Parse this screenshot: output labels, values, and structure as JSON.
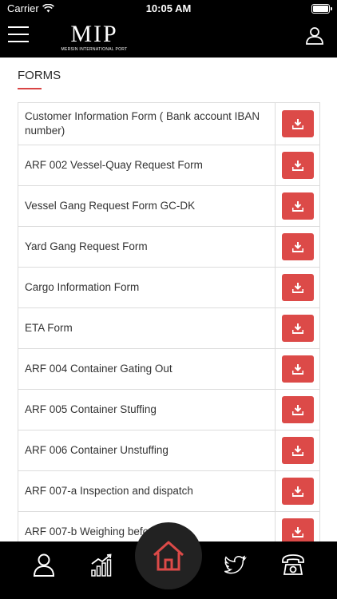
{
  "status": {
    "carrier": "Carrier",
    "time": "10:05 AM"
  },
  "header": {
    "logo_mark": "MIP",
    "logo_sub": "MERSIN INTERNATIONAL PORT",
    "icons": [
      "menu-icon",
      "user-icon"
    ]
  },
  "page": {
    "title": "FORMS"
  },
  "forms": [
    {
      "label": "Customer Information Form ( Bank account IBAN number)"
    },
    {
      "label": "ARF 002 Vessel-Quay Request Form"
    },
    {
      "label": "Vessel Gang Request Form GC-DK"
    },
    {
      "label": "Yard Gang Request Form"
    },
    {
      "label": "Cargo Information Form"
    },
    {
      "label": "ETA Form"
    },
    {
      "label": "ARF 004 Container Gating Out"
    },
    {
      "label": "ARF 005 Container Stuffing"
    },
    {
      "label": "ARF 006 Container Unstuffing"
    },
    {
      "label": "ARF 007-a Inspection and dispatch"
    },
    {
      "label": "ARF 007-b Weighing before"
    }
  ],
  "tabbar": {
    "items": [
      "profile-icon",
      "chart-icon",
      "home-icon",
      "twitter-icon",
      "phone-icon"
    ]
  },
  "colors": {
    "accent": "#dc4a48",
    "header_bg": "#000000"
  }
}
